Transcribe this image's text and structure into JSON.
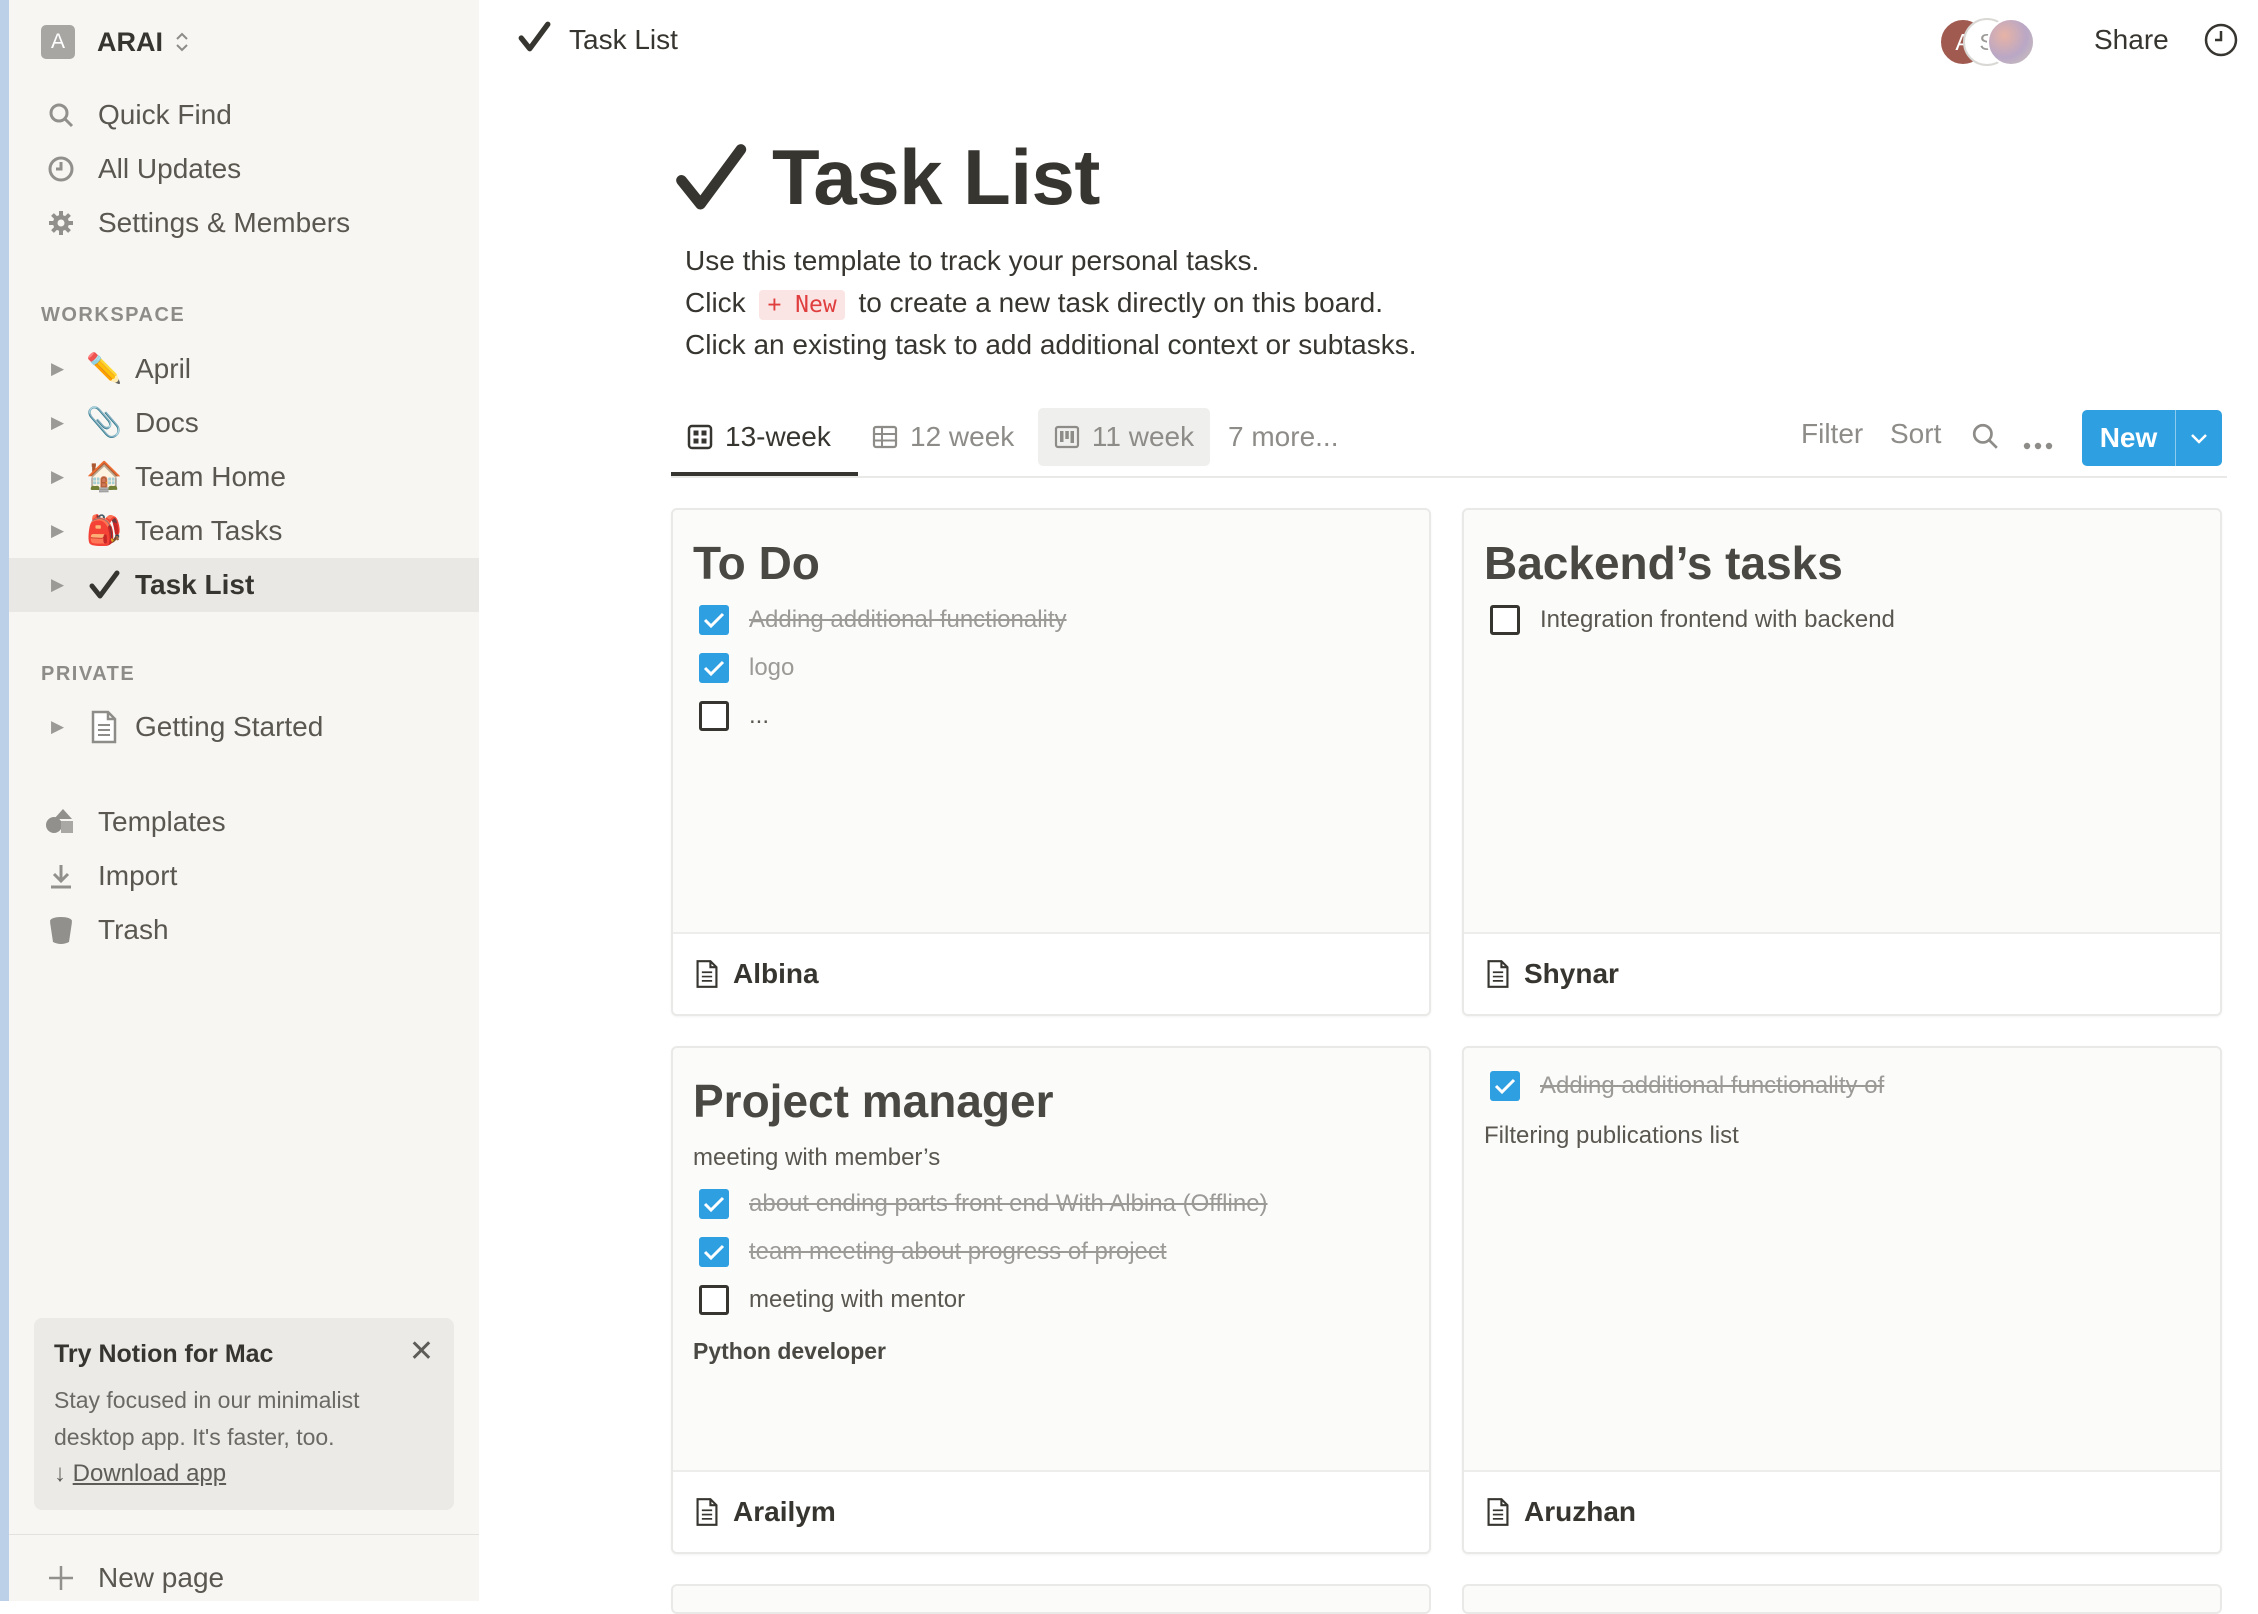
{
  "workspace": {
    "initial": "A",
    "name": "ARAI"
  },
  "sidebar": {
    "top_items": [
      {
        "label": "Quick Find",
        "icon": "search-icon"
      },
      {
        "label": "All Updates",
        "icon": "clock-icon"
      },
      {
        "label": "Settings & Members",
        "icon": "gear-icon"
      }
    ],
    "workspace_header": "WORKSPACE",
    "workspace_pages": [
      {
        "label": "April",
        "icon": "✏️"
      },
      {
        "label": "Docs",
        "icon": "📎"
      },
      {
        "label": "Team Home",
        "icon": "🏠"
      },
      {
        "label": "Team Tasks",
        "icon": "🎒"
      },
      {
        "label": "Task List",
        "icon": "✔",
        "selected": true
      }
    ],
    "private_header": "PRIVATE",
    "private_pages": [
      {
        "label": "Getting Started",
        "icon": "page-icon"
      }
    ],
    "utility_items": [
      {
        "label": "Templates",
        "icon": "templates-icon"
      },
      {
        "label": "Import",
        "icon": "import-icon"
      },
      {
        "label": "Trash",
        "icon": "trash-icon"
      }
    ],
    "promo": {
      "title": "Try Notion for Mac",
      "body": "Stay focused in our minimalist desktop app. It's faster, too.",
      "arrow": "↓",
      "link": "Download app"
    },
    "new_page": "New page"
  },
  "topbar": {
    "breadcrumb_icon": "✔",
    "breadcrumb_title": "Task List",
    "avatars": [
      "A",
      "S",
      ""
    ],
    "share_label": "Share"
  },
  "page": {
    "icon": "✔",
    "title": "Task List",
    "description": {
      "line1": "Use this template to track your personal tasks.",
      "line2_before": "Click",
      "line2_pill": "+ New",
      "line2_after": "to create a new task directly on this board.",
      "line3": "Click an existing task to add additional context or subtasks."
    }
  },
  "views": {
    "tabs": [
      {
        "label": "13-week",
        "icon": "gallery-icon",
        "active": true
      },
      {
        "label": "12 week",
        "icon": "table-icon"
      },
      {
        "label": "11 week",
        "icon": "board-icon"
      }
    ],
    "more": "7 more...",
    "filter": "Filter",
    "sort": "Sort",
    "new_label": "New"
  },
  "cards": [
    {
      "heading": "To Do",
      "items": [
        {
          "text": "Adding additional functionality",
          "checked": true
        },
        {
          "text": "logo",
          "checked": true
        },
        {
          "text": "...",
          "checked": false
        }
      ],
      "footer": "Albina"
    },
    {
      "heading": "Backend’s tasks",
      "items": [
        {
          "text": "Integration frontend with backend",
          "checked": false
        }
      ],
      "footer": "Shynar"
    },
    {
      "heading": "Project manager",
      "subtext": "meeting with member’s",
      "items": [
        {
          "text": "about ending parts front end With Albina (Offline)",
          "checked": true
        },
        {
          "text": "team meeting about progress of project",
          "checked": true
        },
        {
          "text": "meeting with mentor",
          "checked": false
        }
      ],
      "bold_text": "Python developer",
      "footer": "Arailym"
    },
    {
      "items": [
        {
          "text": "Adding additional functionality of",
          "checked": true
        }
      ],
      "subtext": "Filtering publications list",
      "footer": "Aruzhan"
    }
  ],
  "colors": {
    "sidebar_bg": "#f7f6f3",
    "accent": "#2e9fe0",
    "text": "#37352f",
    "muted": "#8e8c88",
    "pill_red": "#e03e3e"
  }
}
